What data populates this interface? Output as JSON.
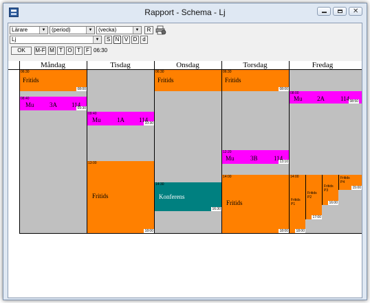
{
  "window": {
    "title": "Rapport - Schema - Lj",
    "close_glyph": "✕"
  },
  "toolbar": {
    "type_select": "Lärare",
    "period_select": "(period)",
    "week_select": "(vecka)",
    "r_button": "R",
    "person_select": "Lj",
    "s_button": "S",
    "n_button": "N",
    "v_button": "V",
    "d_button": "D",
    "d2_button": "d",
    "ok_button": "OK",
    "mf_button": "M-F",
    "m_button": "M",
    "t_button": "T",
    "o_button": "O",
    "t2_button": "T",
    "f_button": "F",
    "start_time": "06:30",
    "dropdown_arrow": "▼"
  },
  "days": [
    "Måndag",
    "Tisdag",
    "Onsdag",
    "Torsdag",
    "Fredag"
  ],
  "events": {
    "mon_fritids": {
      "label": "Fritids",
      "start": "06:30",
      "end": "08:00"
    },
    "mon_mu": {
      "subject": "Mu",
      "group": "3A",
      "room": "114",
      "start": "08:40",
      "end": "09:30"
    },
    "tue_mu": {
      "subject": "Mu",
      "group": "1A",
      "room": "114",
      "start": "09:40",
      "end": "10:30"
    },
    "tue_fritids": {
      "label": "Fritids",
      "start": "13:00",
      "end": "18:00"
    },
    "wed_fritids": {
      "label": "Fritids",
      "start": "06:30",
      "end": "08:00"
    },
    "wed_konferens": {
      "label": "Konferens",
      "start": "14:30",
      "end": "16:30"
    },
    "thu_fritids_morning": {
      "label": "Fritids",
      "start": "06:30",
      "end": "08:00"
    },
    "thu_mu": {
      "subject": "Mu",
      "group": "3B",
      "room": "114",
      "start": "12:20",
      "end": "13:10"
    },
    "thu_fritids": {
      "label": "Fritids",
      "start": "14:00",
      "end": "18:00"
    },
    "fri_mu": {
      "subject": "Mu",
      "group": "2A",
      "room": "114",
      "start": "08:00",
      "end": "08:50"
    },
    "fri_p1": {
      "label": "Fritids",
      "sub": "P1",
      "start": "14:00",
      "end": "18:00"
    },
    "fri_p2": {
      "label": "Fritids",
      "sub": "P2",
      "end": "17:00"
    },
    "fri_p3": {
      "label": "Fritids",
      "sub": "P3",
      "end": "16:00"
    },
    "fri_p4": {
      "label": "Fritids",
      "sub": "P4",
      "end": "15:00"
    }
  },
  "colors": {
    "fritids": "#ff8000",
    "lesson": "#ff00ff",
    "konferens": "#008080",
    "empty_slot": "#c0c0c0"
  }
}
